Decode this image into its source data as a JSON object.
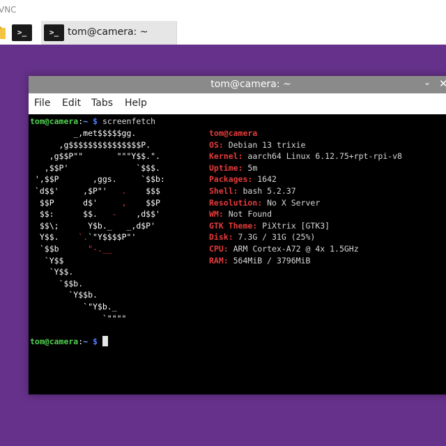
{
  "vnc": {
    "title": "VNC"
  },
  "taskbar": {
    "icons": [
      "folder-icon",
      "terminal-icon"
    ],
    "terminal_glyph": ">_",
    "task": {
      "label": "tom@camera: ~",
      "glyph": ">_"
    }
  },
  "window": {
    "title": "tom@camera: ~",
    "chevron": "⌄",
    "close": "✕",
    "menu": [
      "File",
      "Edit",
      "Tabs",
      "Help"
    ]
  },
  "terminal": {
    "prompt_user": "tom@camera",
    "prompt_sep": ":",
    "prompt_path": "~",
    "prompt_dollar": "$",
    "command": "screenfetch",
    "logo": [
      [
        {
          "t": "         _,met$$$$$gg.",
          "c": "white"
        }
      ],
      [
        {
          "t": "      ,g$$$$$$$$$$$$$$$P.",
          "c": "white"
        }
      ],
      [
        {
          "t": "    ,g$$P\"\"       \"\"\"Y$$.\".",
          "c": "white"
        }
      ],
      [
        {
          "t": "   ,$$P'              `$$$.",
          "c": "white"
        }
      ],
      [
        {
          "t": " ',$$P       ,ggs.     `$$b:",
          "c": "white"
        }
      ],
      [
        {
          "t": " `d$$'     ,$P\"'   ",
          "c": "white"
        },
        {
          "t": ".",
          "c": "red"
        },
        {
          "t": "    $$$",
          "c": "white"
        }
      ],
      [
        {
          "t": "  $$P      d$'     ",
          "c": "white"
        },
        {
          "t": ",",
          "c": "red"
        },
        {
          "t": "    $$P",
          "c": "white"
        }
      ],
      [
        {
          "t": "  $$:      $$.   ",
          "c": "white"
        },
        {
          "t": "-",
          "c": "red"
        },
        {
          "t": "    ,d$$'",
          "c": "white"
        }
      ],
      [
        {
          "t": "  $$\\;      Y$b._   _,d$P'",
          "c": "white"
        }
      ],
      [
        {
          "t": "  Y$$.    ",
          "c": "white"
        },
        {
          "t": "`.",
          "c": "red"
        },
        {
          "t": "`\"Y$$$$P\"'",
          "c": "white"
        }
      ],
      [
        {
          "t": "  `$$b      ",
          "c": "white"
        },
        {
          "t": "\"-.__",
          "c": "red"
        }
      ],
      [
        {
          "t": "   `Y$$",
          "c": "white"
        }
      ],
      [
        {
          "t": "    `Y$$.",
          "c": "white"
        }
      ],
      [
        {
          "t": "      `$$b.",
          "c": "white"
        }
      ],
      [
        {
          "t": "        `Y$$b.",
          "c": "white"
        }
      ],
      [
        {
          "t": "           `\"Y$b._",
          "c": "white"
        }
      ],
      [
        {
          "t": "               `\"\"\"\"",
          "c": "white"
        }
      ]
    ],
    "info_header": "tom@camera",
    "info": [
      {
        "key": "OS:",
        "value": " Debian 13 trixie"
      },
      {
        "key": "Kernel:",
        "value": " aarch64 Linux 6.12.75+rpt-rpi-v8"
      },
      {
        "key": "Uptime:",
        "value": " 5m"
      },
      {
        "key": "Packages:",
        "value": " 1642"
      },
      {
        "key": "Shell:",
        "value": " bash 5.2.37"
      },
      {
        "key": "Resolution:",
        "value": " No X Server"
      },
      {
        "key": "WM:",
        "value": " Not Found"
      },
      {
        "key": "GTK Theme:",
        "value": " PiXtrix [GTK3]"
      },
      {
        "key": "Disk:",
        "value": " 7.3G / 31G (25%)"
      },
      {
        "key": "CPU:",
        "value": " ARM Cortex-A72 @ 4x 1.5GHz"
      },
      {
        "key": "RAM:",
        "value": " 564MiB / 3796MiB"
      }
    ]
  },
  "colors": {
    "desktop": "#65318a",
    "prompt_user": "#4fd14f",
    "prompt_path": "#6f9cff",
    "info_key": "#e53b3b",
    "titlebar": "#8a8a8a"
  }
}
